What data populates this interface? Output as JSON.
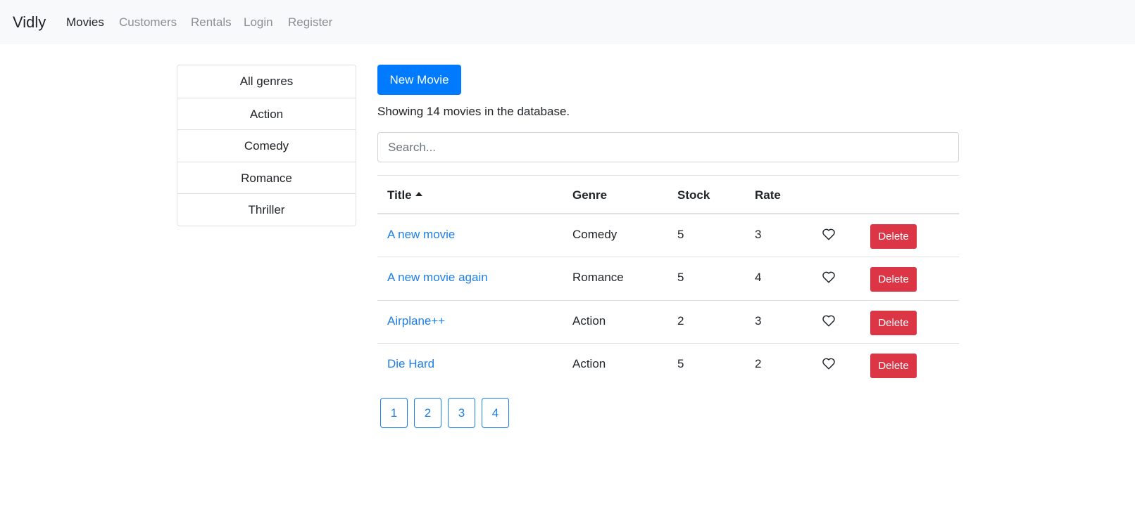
{
  "navbar": {
    "brand": "Vidly",
    "links": [
      "Movies",
      "Customers",
      "Rentals",
      "Login",
      "Register"
    ],
    "active_link": "Movies"
  },
  "genres": [
    "All genres",
    "Action",
    "Comedy",
    "Romance",
    "Thriller"
  ],
  "toolbar": {
    "new_movie_label": "New Movie",
    "count_text": "Showing 14 movies in the database."
  },
  "search": {
    "placeholder": "Search..."
  },
  "table": {
    "headers": [
      "Title",
      "Genre",
      "Stock",
      "Rate"
    ],
    "sort_column": "Title",
    "rows": [
      {
        "title": "A new movie",
        "genre": "Comedy",
        "stock": "5",
        "rate": "3"
      },
      {
        "title": "A new movie again",
        "genre": "Romance",
        "stock": "5",
        "rate": "4"
      },
      {
        "title": "Airplane++",
        "genre": "Action",
        "stock": "2",
        "rate": "3"
      },
      {
        "title": "Die Hard",
        "genre": "Action",
        "stock": "5",
        "rate": "2"
      }
    ],
    "delete_label": "Delete"
  },
  "pagination": [
    "1",
    "2",
    "3",
    "4"
  ],
  "colors": {
    "primary": "#007bff",
    "danger": "#dc3545",
    "link": "#1d7fe6",
    "navbar_bg": "#f8f9fa"
  }
}
